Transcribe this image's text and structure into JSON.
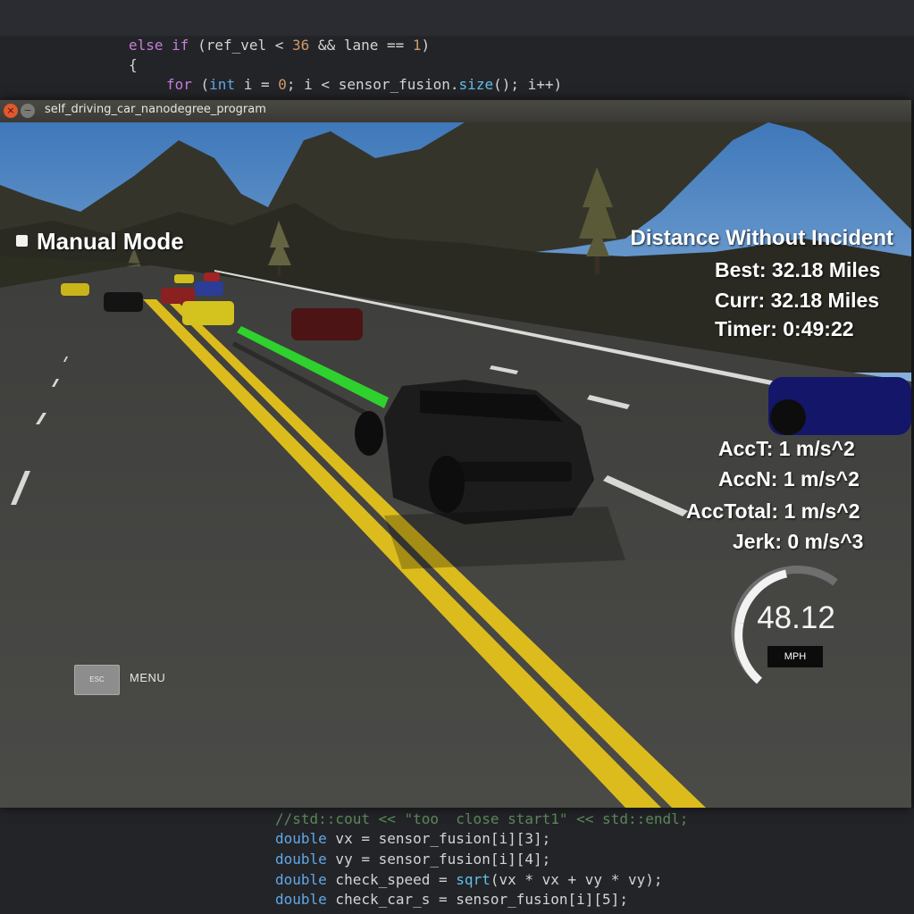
{
  "editor": {
    "code_top": [
      {
        "kw1": "else if",
        "t1": " (ref_vel < ",
        "num1": "36",
        "t2": " && lane == ",
        "num2": "1",
        "t3": ")"
      },
      {
        "t1": "{"
      },
      {
        "kw1": "for",
        "t1": " (",
        "ty1": "int",
        "t2": " i = ",
        "num1": "0",
        "t3": "; i < sensor_fusion.",
        "fn1": "size",
        "t4": "(); i++)"
      }
    ],
    "code_bottom": {
      "comment": "//std::cout << \"too  close start1\" << std::endl;",
      "line_vx": {
        "type": "double",
        "rest": " vx = sensor_fusion[i][3];"
      },
      "line_vy": {
        "type": "double",
        "rest": " vy = sensor_fusion[i][4];"
      },
      "line_speed": {
        "type": "double",
        "mid": " check_speed = ",
        "fn": "sqrt",
        "rest": "(vx * vx + vy * vy);"
      },
      "line_s": {
        "type": "double",
        "rest": " check_car_s = sensor_fusion[i][5];"
      }
    }
  },
  "window": {
    "title": "self_driving_car_nanodegree_program",
    "close_glyph": "×",
    "minimize_glyph": "−"
  },
  "hud": {
    "manual_mode_label": "Manual Mode",
    "distance_title": "Distance Without Incident",
    "best": "Best: 32.18 Miles",
    "curr": "Curr: 32.18 Miles",
    "timer": "Timer: 0:49:22",
    "acc_t": "AccT: 1 m/s^2",
    "acc_n": "AccN: 1 m/s^2",
    "acc_total": "AccTotal: 1 m/s^2",
    "jerk": "Jerk: 0 m/s^3"
  },
  "speedometer": {
    "value": "48.12",
    "unit": "MPH",
    "fill_fraction": 0.48
  },
  "menu": {
    "esc_label": "ESC",
    "menu_label": "MENU"
  },
  "colors": {
    "path_green": "#2ed12e",
    "lane_yellow": "#e3c21c",
    "sky": "#4b82c0"
  }
}
